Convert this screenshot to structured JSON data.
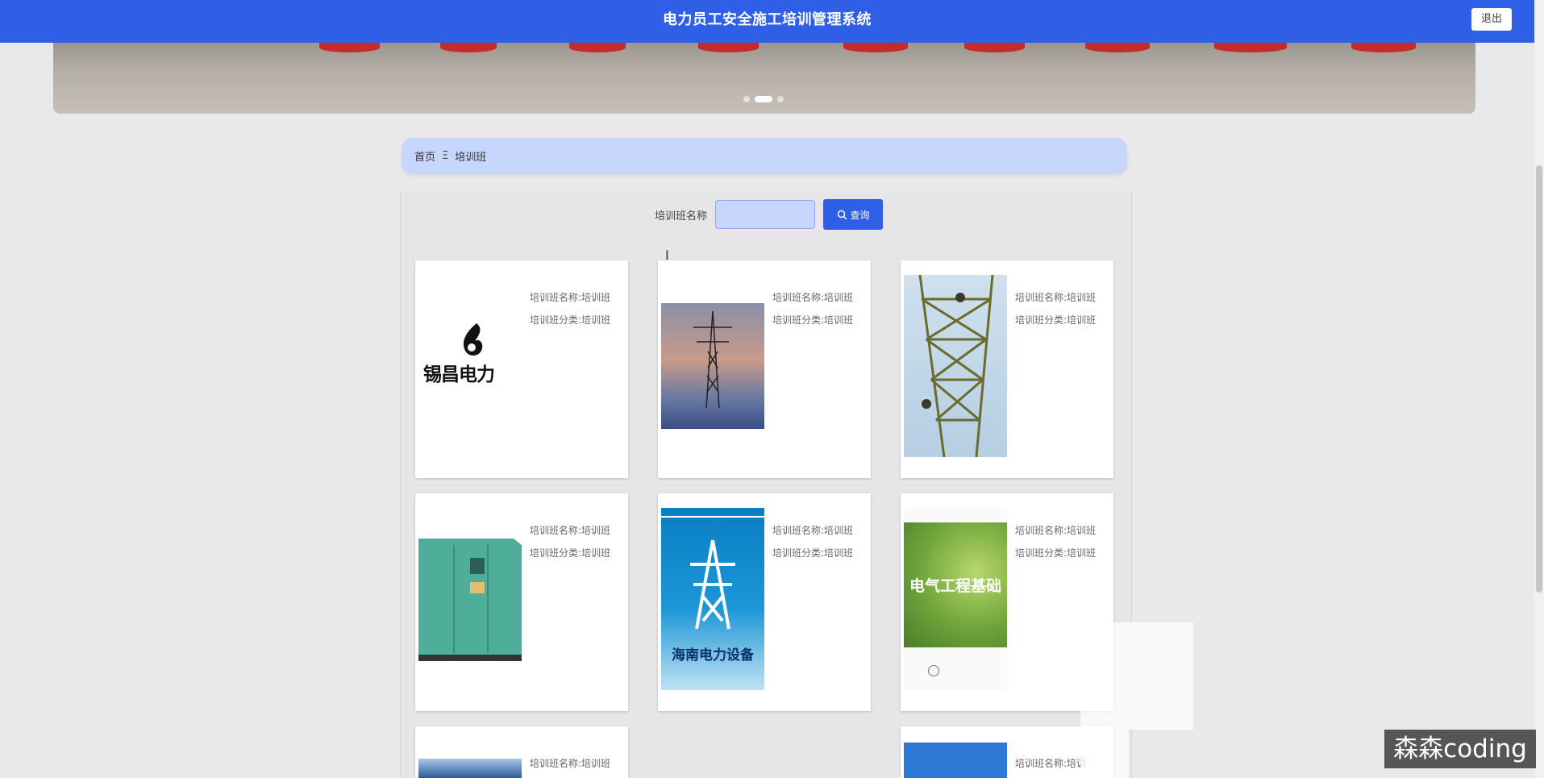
{
  "header": {
    "title": "电力员工安全施工培训管理系统",
    "logout_label": "退出"
  },
  "breadcrumb": {
    "home": "首页",
    "separator": "Ξ",
    "current": "培训班"
  },
  "search": {
    "label": "培训班名称",
    "value": "",
    "button_label": "查询"
  },
  "cards": [
    {
      "name": "培训班名称:培训班",
      "category": "培训班分类:培训班",
      "image": "xiyang-power-logo",
      "image_text": "锡昌电力"
    },
    {
      "name": "培训班名称:培训班",
      "category": "培训班分类:培训班",
      "image": "power-tower-sunset"
    },
    {
      "name": "培训班名称:培训班",
      "category": "培训班分类:培训班",
      "image": "tower-climber"
    },
    {
      "name": "培训班名称:培训班",
      "category": "培训班分类:培训班",
      "image": "green-substation-box"
    },
    {
      "name": "培训班名称:培训班",
      "category": "培训班分类:培训班",
      "image": "power-equipment-poster",
      "image_text": "海南电力设备"
    },
    {
      "name": "培训班名称:培训班",
      "category": "培训班分类:培训班",
      "image": "electrical-engineering-book",
      "image_text": "电气工程基础"
    },
    {
      "name": "培训班名称:培训班",
      "category": "",
      "image": "partial-blue-photo"
    },
    {
      "name": "培训班名称:培训",
      "category": "",
      "image": "partial-blue-cover"
    }
  ],
  "watermark": "森森coding",
  "colors": {
    "primary": "#2f5fe6",
    "breadcrumb_bg": "#c7d6fc",
    "page_bg": "#e9e9eb"
  }
}
